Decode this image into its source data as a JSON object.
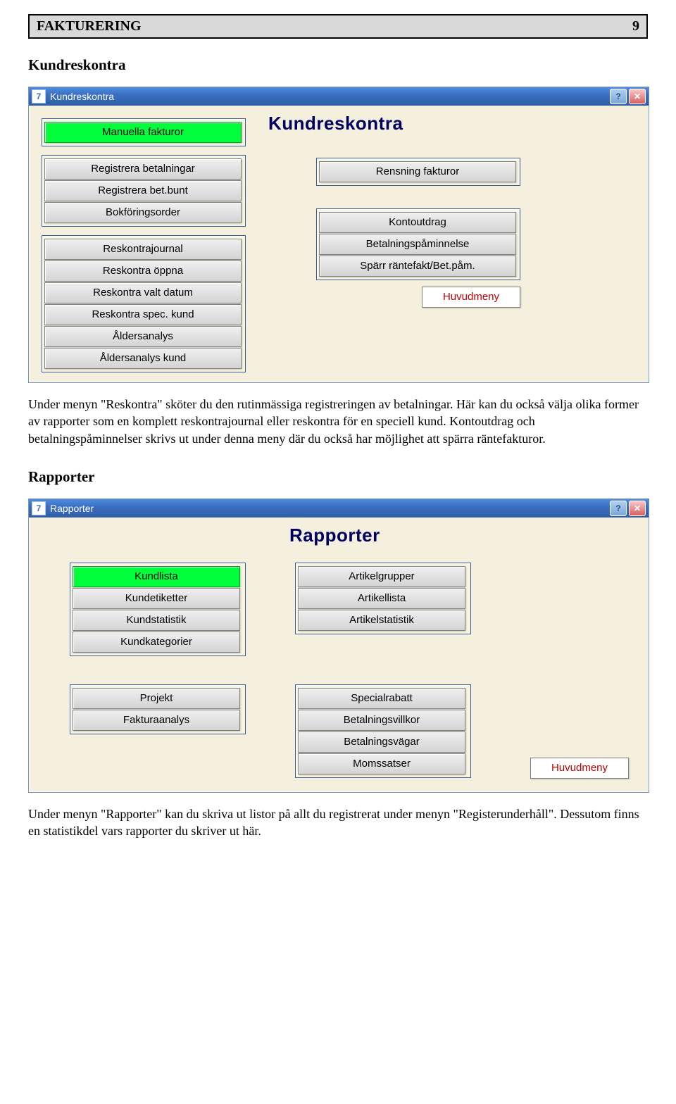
{
  "doc": {
    "header_title": "FAKTURERING",
    "header_page": "9",
    "section1_title": "Kundreskontra",
    "section1_paragraph": "Under menyn \"Reskontra\" sköter du den rutinmässiga registreringen av betalningar. Här kan du också välja olika former av rapporter som en komplett reskontrajournal eller reskontra för en speciell kund. Kontoutdrag och betalningspåminnelser skrivs ut under denna meny där du också har möjlighet att spärra räntefakturor.",
    "section2_title": "Rapporter",
    "section2_paragraph": "Under menyn \"Rapporter\" kan du skriva ut listor på allt du registrerat under menyn \"Registerunderhåll\". Dessutom finns en statistikdel vars rapporter du skriver ut här."
  },
  "win1": {
    "app_icon_text": "7",
    "title": "Kundreskontra",
    "heading": "Kundreskontra",
    "left_group1": [
      "Manuella fakturor"
    ],
    "left_group2": [
      "Registrera betalningar",
      "Registrera bet.bunt",
      "Bokföringsorder"
    ],
    "left_group3": [
      "Reskontrajournal",
      "Reskontra öppna",
      "Reskontra valt datum",
      "Reskontra spec. kund",
      "Åldersanalys",
      "Åldersanalys kund"
    ],
    "right_group1": [
      "Rensning fakturor"
    ],
    "right_group2": [
      "Kontoutdrag",
      "Betalningspåminnelse",
      "Spärr räntefakt/Bet.påm."
    ],
    "huvudmeny": "Huvudmeny"
  },
  "win2": {
    "app_icon_text": "7",
    "title": "Rapporter",
    "heading": "Rapporter",
    "left_group1": [
      "Kundlista",
      "Kundetiketter",
      "Kundstatistik",
      "Kundkategorier"
    ],
    "right_group1": [
      "Artikelgrupper",
      "Artikellista",
      "Artikelstatistik"
    ],
    "left_group2": [
      "Projekt",
      "Fakturaanalys"
    ],
    "right_group2": [
      "Specialrabatt",
      "Betalningsvillkor",
      "Betalningsvägar",
      "Momssatser"
    ],
    "huvudmeny": "Huvudmeny"
  }
}
